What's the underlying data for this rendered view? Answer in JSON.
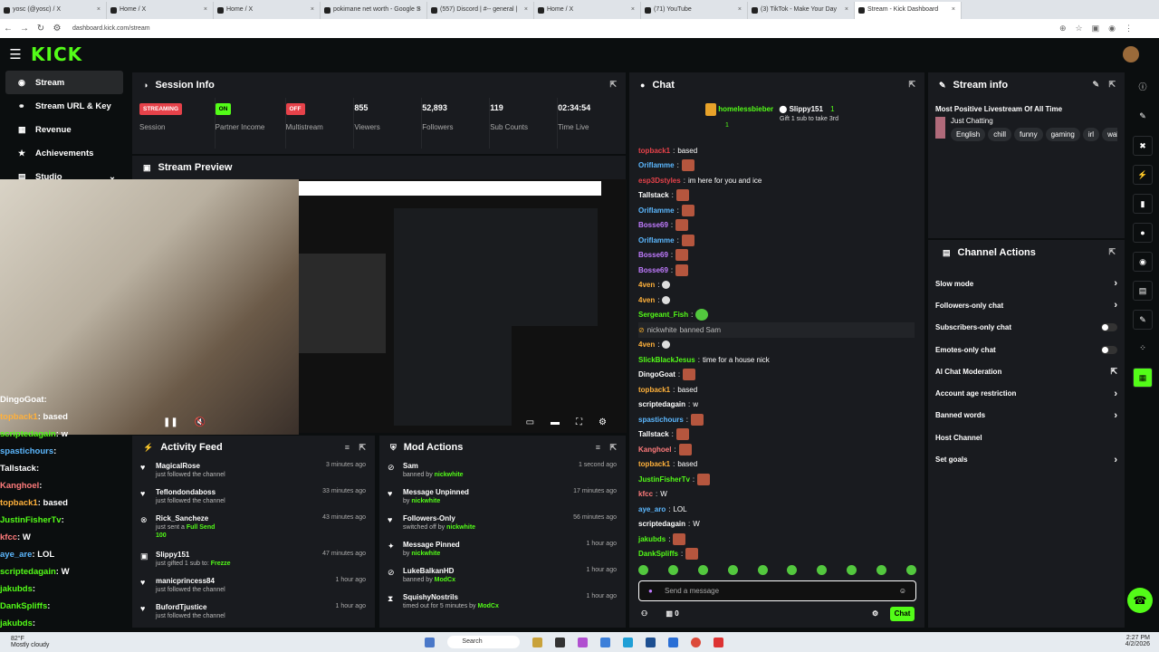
{
  "browser": {
    "tabs": [
      {
        "label": "yosc (@yosc) / X"
      },
      {
        "label": "Home / X"
      },
      {
        "label": "Home / X"
      },
      {
        "label": "pokimane net worth - Google S"
      },
      {
        "label": "(557) Discord | #-- general |"
      },
      {
        "label": "Home / X"
      },
      {
        "label": "(71) YouTube"
      },
      {
        "label": "(3) TikTok - Make Your Day"
      },
      {
        "label": "Stream - Kick Dashboard"
      }
    ],
    "url": "dashboard.kick.com/stream"
  },
  "app": {
    "logo": "KICK"
  },
  "sidebar": {
    "items": [
      {
        "label": "Stream"
      },
      {
        "label": "Stream URL & Key"
      },
      {
        "label": "Revenue"
      },
      {
        "label": "Achievements"
      },
      {
        "label": "Studio"
      }
    ]
  },
  "session": {
    "title": "Session Info",
    "streaming_badge": "STREAMING",
    "session_label": "Session",
    "on_badge": "ON",
    "partner_label": "Partner Income",
    "off_badge": "OFF",
    "multistream_label": "Multistream",
    "viewers": "855",
    "viewers_label": "Viewers",
    "followers": "52,893",
    "followers_label": "Followers",
    "subs": "119",
    "subs_label": "Sub Counts",
    "time": "02:34:54",
    "time_label": "Time Live"
  },
  "preview": {
    "title": "Stream Preview"
  },
  "overlay_chat": [
    {
      "user": "DingoGoat",
      "msg": ""
    },
    {
      "user": "topback1",
      "msg": "based"
    },
    {
      "user": "scriptedagain",
      "msg": "w"
    },
    {
      "user": "spastichours",
      "msg": ""
    },
    {
      "user": "Tallstack",
      "msg": ""
    },
    {
      "user": "Kanghoel",
      "msg": ""
    },
    {
      "user": "topback1",
      "msg": "based"
    },
    {
      "user": "JustinFisherTv",
      "msg": ""
    },
    {
      "user": "kfcc",
      "msg": "W"
    },
    {
      "user": "aye_are",
      "msg": "LOL"
    },
    {
      "user": "scriptedagain",
      "msg": "W"
    },
    {
      "user": "jakubds",
      "msg": ""
    },
    {
      "user": "DankSpliffs",
      "msg": ""
    },
    {
      "user": "jakubds",
      "msg": ""
    }
  ],
  "activity": {
    "title": "Activity Feed",
    "items": [
      {
        "name": "MagicalRose",
        "desc": "just followed the channel",
        "time": "3 minutes ago"
      },
      {
        "name": "Teflondondaboss",
        "desc": "just followed the channel",
        "time": "33 minutes ago"
      },
      {
        "name": "Rick_Sancheze",
        "desc": "just sent a",
        "desc_hl": "Full Send",
        "extra": "100",
        "time": "43 minutes ago"
      },
      {
        "name": "Slippy151",
        "desc": "just gifted 1 sub to:",
        "desc_hl": "Frezze",
        "time": "47 minutes ago"
      },
      {
        "name": "manicprincess84",
        "desc": "just followed the channel",
        "time": "1 hour ago"
      },
      {
        "name": "BufordTjustice",
        "desc": "just followed the channel",
        "time": "1 hour ago"
      }
    ]
  },
  "mod": {
    "title": "Mod Actions",
    "items": [
      {
        "name": "Sam",
        "desc": "banned by",
        "by": "nickwhite",
        "time": "1 second ago"
      },
      {
        "name": "Message Unpinned",
        "desc": "by",
        "by": "nickwhite",
        "time": "17 minutes ago"
      },
      {
        "name": "Followers-Only",
        "desc": "switched off by",
        "by": "nickwhite",
        "time": "56 minutes ago"
      },
      {
        "name": "Message Pinned",
        "desc": "by",
        "by": "nickwhite",
        "time": "1 hour ago"
      },
      {
        "name": "LukeBalkanHD",
        "desc": "banned by",
        "by": "ModCx",
        "time": "1 hour ago"
      },
      {
        "name": "SquishyNostrils",
        "desc": "timed out for 5 minutes by",
        "by": "ModCx",
        "time": "1 hour ago"
      }
    ]
  },
  "chat": {
    "title": "Chat",
    "pinned_user": "homelessbieber",
    "pinned_user2": "Slippy151",
    "pinned_count": "1",
    "pinned_count2": "1",
    "pinned_gift": "Gift 1 sub to take 3rd",
    "messages": [
      {
        "user": "topback1",
        "msg": "based",
        "color": "#e6424a"
      },
      {
        "user": "Oriflamme",
        "msg": "",
        "color": "#5cb8ff"
      },
      {
        "user": "esp3Dstyles",
        "msg": "im here for you and ice",
        "color": "#e6424a"
      },
      {
        "user": "Tallstack",
        "msg": "",
        "color": "#fff"
      },
      {
        "user": "Oriflamme",
        "msg": "",
        "color": "#5cb8ff"
      },
      {
        "user": "Bosse69",
        "msg": "",
        "color": "#c07bff"
      },
      {
        "user": "Oriflamme",
        "msg": "",
        "color": "#5cb8ff"
      },
      {
        "user": "Bosse69",
        "msg": "",
        "color": "#c07bff"
      },
      {
        "user": "Bosse69",
        "msg": "",
        "color": "#c07bff"
      },
      {
        "user": "4ven",
        "msg": "",
        "color": "#ffb13b"
      },
      {
        "user": "4ven",
        "msg": "",
        "color": "#ffb13b"
      },
      {
        "user": "Sergeant_Fish",
        "msg": "",
        "color": "#53fc18"
      },
      {
        "user": "nickwhite",
        "msg": "banned Sam",
        "color": "#bbb",
        "sys": true
      },
      {
        "user": "4ven",
        "msg": "",
        "color": "#ffb13b"
      },
      {
        "user": "SlickBlackJesus",
        "msg": "time for a house nick",
        "color": "#53fc18"
      },
      {
        "user": "DingoGoat",
        "msg": "",
        "color": "#fff"
      },
      {
        "user": "topback1",
        "msg": "based",
        "color": "#ffb13b"
      },
      {
        "user": "scriptedagain",
        "msg": "w",
        "color": "#fff"
      },
      {
        "user": "spastichours",
        "msg": "",
        "color": "#5cb8ff"
      },
      {
        "user": "Tallstack",
        "msg": "",
        "color": "#fff"
      },
      {
        "user": "Kanghoel",
        "msg": "",
        "color": "#ff7b7b"
      },
      {
        "user": "topback1",
        "msg": "based",
        "color": "#ffb13b"
      },
      {
        "user": "JustinFisherTv",
        "msg": "",
        "color": "#53fc18"
      },
      {
        "user": "kfcc",
        "msg": "W",
        "color": "#ff7b7b"
      },
      {
        "user": "aye_aro",
        "msg": "LOL",
        "color": "#5cb8ff"
      },
      {
        "user": "scriptedagain",
        "msg": "W",
        "color": "#fff"
      },
      {
        "user": "jakubds",
        "msg": "",
        "color": "#53fc18"
      },
      {
        "user": "DankSpliffs",
        "msg": "",
        "color": "#53fc18"
      }
    ],
    "input_placeholder": "Send a message",
    "count": "0",
    "send_label": "Chat"
  },
  "stream_info": {
    "title": "Stream info",
    "stream_title": "Most Positive Livestream Of All Time",
    "category": "Just Chatting",
    "tags": [
      "English",
      "chill",
      "funny",
      "gaming",
      "irl",
      "wal"
    ]
  },
  "channel_actions": {
    "title": "Channel Actions",
    "items": [
      {
        "label": "Slow mode",
        "kind": "arrow"
      },
      {
        "label": "Followers-only chat",
        "kind": "arrow"
      },
      {
        "label": "Subscribers-only chat",
        "kind": "toggle"
      },
      {
        "label": "Emotes-only chat",
        "kind": "toggle"
      },
      {
        "label": "AI Chat Moderation",
        "kind": "ext"
      },
      {
        "label": "Account age restriction",
        "kind": "arrow"
      },
      {
        "label": "Banned words",
        "kind": "arrow"
      },
      {
        "label": "Host Channel",
        "kind": "none"
      },
      {
        "label": "Set goals",
        "kind": "arrow"
      }
    ]
  },
  "taskbar": {
    "weather_temp": "82°F",
    "weather_desc": "Mostly cloudy",
    "search": "Search",
    "time": "2:27 PM",
    "date": "4/2/2026"
  },
  "colors": {
    "accent": "#53fc18",
    "panel": "#191b1f"
  }
}
